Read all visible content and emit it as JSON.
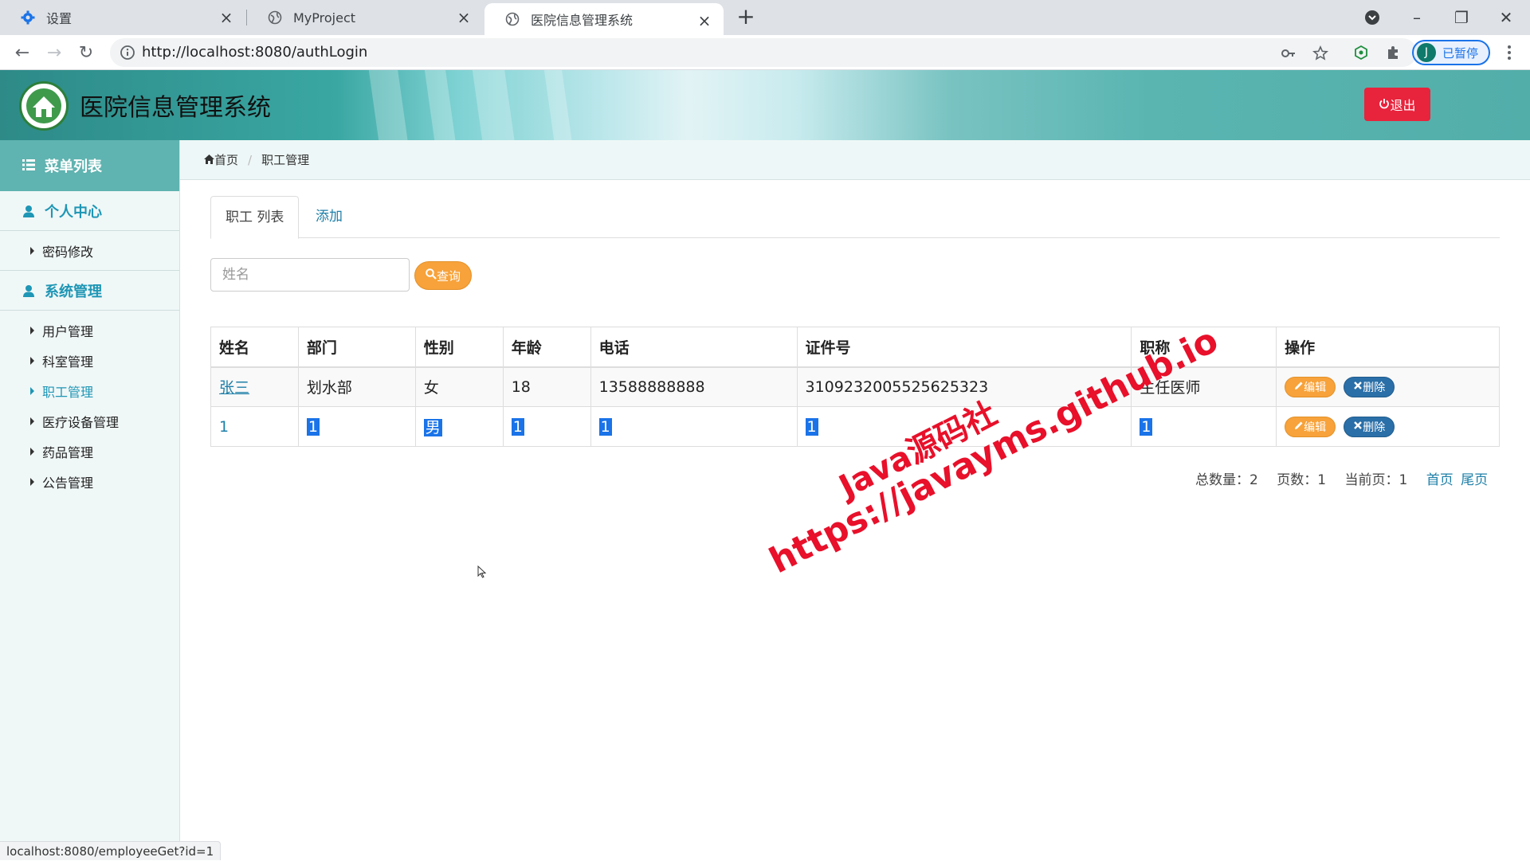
{
  "browser": {
    "tabs": [
      {
        "title": "设置",
        "icon": "gear-icon"
      },
      {
        "title": "MyProject",
        "icon": "globe-icon"
      },
      {
        "title": "医院信息管理系统",
        "icon": "globe-icon"
      }
    ],
    "url": "http://localhost:8080/authLogin",
    "profile_initial": "J",
    "profile_label": "已暂停"
  },
  "header": {
    "title": "医院信息管理系统",
    "logout_label": "退出"
  },
  "sidebar": {
    "heading": "菜单列表",
    "groups": [
      {
        "label": "个人中心",
        "items": [
          {
            "label": "密码修改"
          }
        ]
      },
      {
        "label": "系统管理",
        "items": [
          {
            "label": "用户管理"
          },
          {
            "label": "科室管理"
          },
          {
            "label": "职工管理"
          },
          {
            "label": "医疗设备管理"
          },
          {
            "label": "药品管理"
          },
          {
            "label": "公告管理"
          }
        ]
      }
    ],
    "active_item": "职工管理"
  },
  "breadcrumb": {
    "home": "首页",
    "current": "职工管理"
  },
  "content_tabs": {
    "list": "职工 列表",
    "add": "添加"
  },
  "search": {
    "placeholder": "姓名",
    "button_label": "查询"
  },
  "table": {
    "headers": [
      "姓名",
      "部门",
      "性别",
      "年龄",
      "电话",
      "证件号",
      "职称",
      "操作"
    ],
    "rows": [
      {
        "name": "张三",
        "dept": "划水部",
        "gender": "女",
        "age": "18",
        "phone": "13588888888",
        "id_no": "3109232005525625323",
        "title": "主任医师"
      },
      {
        "name": "1",
        "dept": "1",
        "gender": "男",
        "age": "1",
        "phone": "1",
        "id_no": "1",
        "title": "1"
      }
    ],
    "edit_label": "编辑",
    "delete_label": "删除"
  },
  "pager": {
    "total": "总数量：2",
    "pages": "页数：1",
    "current": "当前页：1",
    "first": "首页",
    "last": "尾页"
  },
  "watermark": {
    "line1": "Java源码社",
    "line2": "https://javayms.github.io"
  },
  "status_url": "localhost:8080/employeeGet?id=1",
  "colors": {
    "accent": "#1e96b5",
    "danger": "#e8233c",
    "warning": "#f7a23a",
    "primary": "#2a6fa8"
  }
}
